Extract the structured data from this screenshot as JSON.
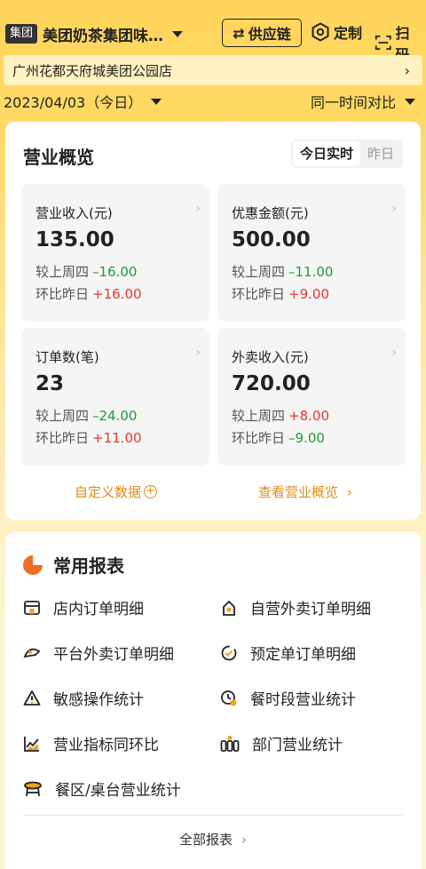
{
  "topbar": {
    "group_badge": "集团",
    "brand_name": "美团奶茶集团味…",
    "supply_label": "供应链",
    "custom_label": "定制",
    "scan_label": "扫码"
  },
  "store": {
    "name": "广州花都天府城美团公园店",
    "chevron": "›"
  },
  "date_row": {
    "date": "2023/04/03（今日）",
    "compare": "同一时间对比"
  },
  "overview": {
    "title": "营业概览",
    "tabs": [
      {
        "label": "今日实时",
        "active": true
      },
      {
        "label": "昨日",
        "active": false
      }
    ],
    "metrics": [
      {
        "label": "营业收入(元)",
        "value": "135.00",
        "cmp1_label": "较上周四",
        "cmp1_value": "–16.00",
        "cmp2_label": "环比昨日",
        "cmp2_value": "+16.00"
      },
      {
        "label": "优惠金额(元)",
        "value": "500.00",
        "cmp1_label": "较上周四",
        "cmp1_value": "–11.00",
        "cmp2_label": "环比昨日",
        "cmp2_value": "+9.00"
      },
      {
        "label": "订单数(笔)",
        "value": "23",
        "cmp1_label": "较上周四",
        "cmp1_value": "–24.00",
        "cmp2_label": "环比昨日",
        "cmp2_value": "+11.00"
      },
      {
        "label": "外卖收入(元)",
        "value": "720.00",
        "cmp1_label": "较上周四",
        "cmp1_value": "+8.00",
        "cmp2_label": "环比昨日",
        "cmp2_value": "–9.00"
      }
    ],
    "custom_data_label": "自定义数据",
    "view_overview_label": "查看营业概览"
  },
  "reports": {
    "title": "常用报表",
    "items": [
      {
        "label": "店内订单明细",
        "icon": "store-icon"
      },
      {
        "label": "自营外卖订单明细",
        "icon": "delivery-bag-icon"
      },
      {
        "label": "平台外卖订单明细",
        "icon": "scooter-icon"
      },
      {
        "label": "预定单订单明细",
        "icon": "reservation-check-icon"
      },
      {
        "label": "敏感操作统计",
        "icon": "warning-icon"
      },
      {
        "label": "餐时段营业统计",
        "icon": "clock-user-icon"
      },
      {
        "label": "营业指标同环比",
        "icon": "trend-chart-icon"
      },
      {
        "label": "部门营业统计",
        "icon": "departments-icon"
      },
      {
        "label": "餐区/桌台营业统计",
        "icon": "table-icon"
      }
    ],
    "all_label": "全部报表"
  },
  "colors": {
    "accent_orange": "#e08b16",
    "up_red": "#e33333",
    "down_green": "#1f9a3a",
    "bg_yellow": "#ffd45a"
  }
}
